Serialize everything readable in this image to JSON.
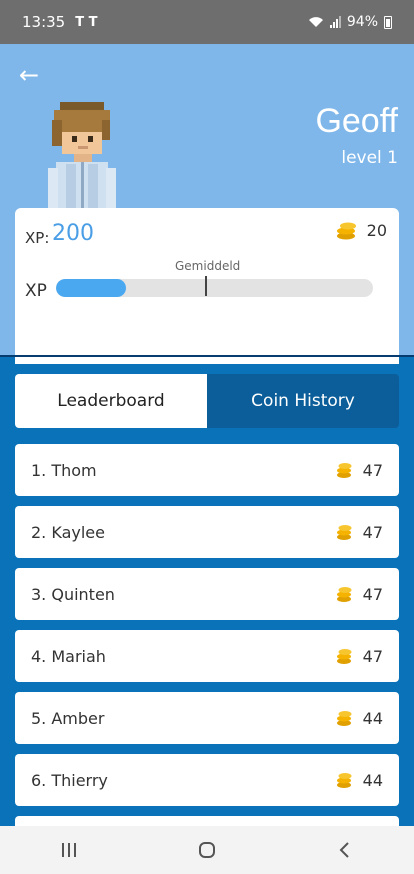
{
  "status_bar": {
    "time": "13:35",
    "tesla": "Τ Τ",
    "battery": "94%"
  },
  "profile": {
    "name": "Geoff",
    "level": "level 1"
  },
  "stats": {
    "xp_label": "XP:",
    "xp_value": "200",
    "coins": "20",
    "average_label": "Gemiddeld",
    "bar_label": "XP",
    "xp_progress": 0.22,
    "average_position": 0.47
  },
  "tabs": [
    {
      "label": "Leaderboard",
      "active": true
    },
    {
      "label": "Coin History",
      "active": false
    }
  ],
  "leaderboard": [
    {
      "rank": "1. Thom",
      "coins": "47"
    },
    {
      "rank": "2. Kaylee",
      "coins": "47"
    },
    {
      "rank": "3. Quinten",
      "coins": "47"
    },
    {
      "rank": "4. Mariah",
      "coins": "47"
    },
    {
      "rank": "5. Amber",
      "coins": "44"
    },
    {
      "rank": "6. Thierry",
      "coins": "44"
    }
  ],
  "colors": {
    "header": "#7fb7ea",
    "accent": "#4aa8f0",
    "page": "#0a72b8",
    "coin": "#f5b300"
  }
}
